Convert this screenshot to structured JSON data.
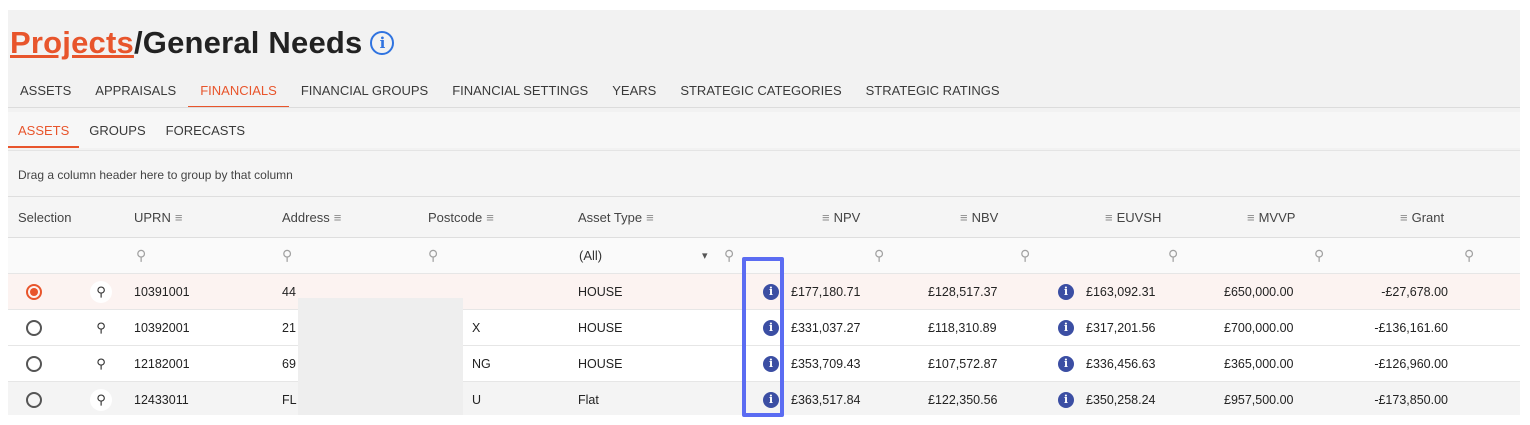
{
  "title": {
    "crumb": "Projects",
    "separator": "/",
    "page": "General Needs",
    "info_glyph": "i"
  },
  "tabs": [
    "ASSETS",
    "APPRAISALS",
    "FINANCIALS",
    "FINANCIAL GROUPS",
    "FINANCIAL SETTINGS",
    "YEARS",
    "STRATEGIC CATEGORIES",
    "STRATEGIC RATINGS"
  ],
  "active_tab": "FINANCIALS",
  "subtabs": [
    "ASSETS",
    "GROUPS",
    "FORECASTS"
  ],
  "active_subtab": "ASSETS",
  "group_panel_text": "Drag a column header here to group by that column",
  "columns": {
    "selection": "Selection",
    "uprn": "UPRN",
    "address": "Address",
    "postcode": "Postcode",
    "asset_type": "Asset Type",
    "npv": "NPV",
    "nbv": "NBV",
    "euvsh": "EUVSH",
    "mvvp": "MVVP",
    "grant": "Grant"
  },
  "filter": {
    "asset_type_value": "(All)",
    "dropdown_glyph": "▾",
    "search_glyph": "⚲"
  },
  "rows": [
    {
      "selected": true,
      "uprn": "10391001",
      "address": "44",
      "postcode": "",
      "asset_type": "HOUSE",
      "npv": "£177,180.71",
      "nbv": "£128,517.37",
      "euvsh": "£163,092.31",
      "mvvp": "£650,000.00",
      "grant": "-£27,678.00"
    },
    {
      "selected": false,
      "uprn": "10392001",
      "address": "21",
      "postcode": "X",
      "asset_type": "HOUSE",
      "npv": "£331,037.27",
      "nbv": "£118,310.89",
      "euvsh": "£317,201.56",
      "mvvp": "£700,000.00",
      "grant": "-£136,161.60"
    },
    {
      "selected": false,
      "uprn": "12182001",
      "address": "69",
      "postcode": "NG",
      "asset_type": "HOUSE",
      "npv": "£353,709.43",
      "nbv": "£107,572.87",
      "euvsh": "£336,456.63",
      "mvvp": "£365,000.00",
      "grant": "-£126,960.00"
    },
    {
      "selected": false,
      "uprn": "12433011",
      "address": "FL",
      "postcode": "U",
      "asset_type": "Flat",
      "npv": "£363,517.84",
      "nbv": "£122,350.56",
      "euvsh": "£350,258.24",
      "mvvp": "£957,500.00",
      "grant": "-£173,850.00"
    }
  ],
  "colors": {
    "accent": "#e8552c",
    "info": "#3b4ea3",
    "highlight": "#5b6cf2"
  }
}
